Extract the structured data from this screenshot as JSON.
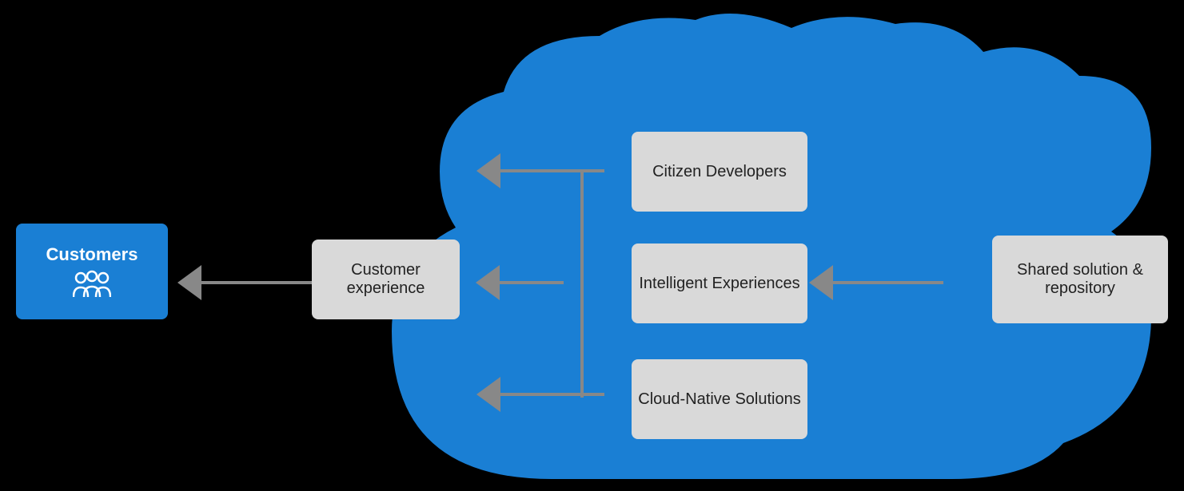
{
  "customers": {
    "label": "Customers",
    "icon": "👥"
  },
  "cx": {
    "label": "Customer experience"
  },
  "citizen": {
    "label": "Citizen Developers"
  },
  "intelligent": {
    "label": "Intelligent Experiences"
  },
  "cloudNative": {
    "label": "Cloud-Native Solutions"
  },
  "shared": {
    "label": "Shared solution & repository"
  },
  "colors": {
    "blue": "#1a7fd4",
    "boxBg": "#d9d9d9",
    "arrowColor": "#888888",
    "cloudColor": "#1a7fd4",
    "background": "#000000"
  }
}
